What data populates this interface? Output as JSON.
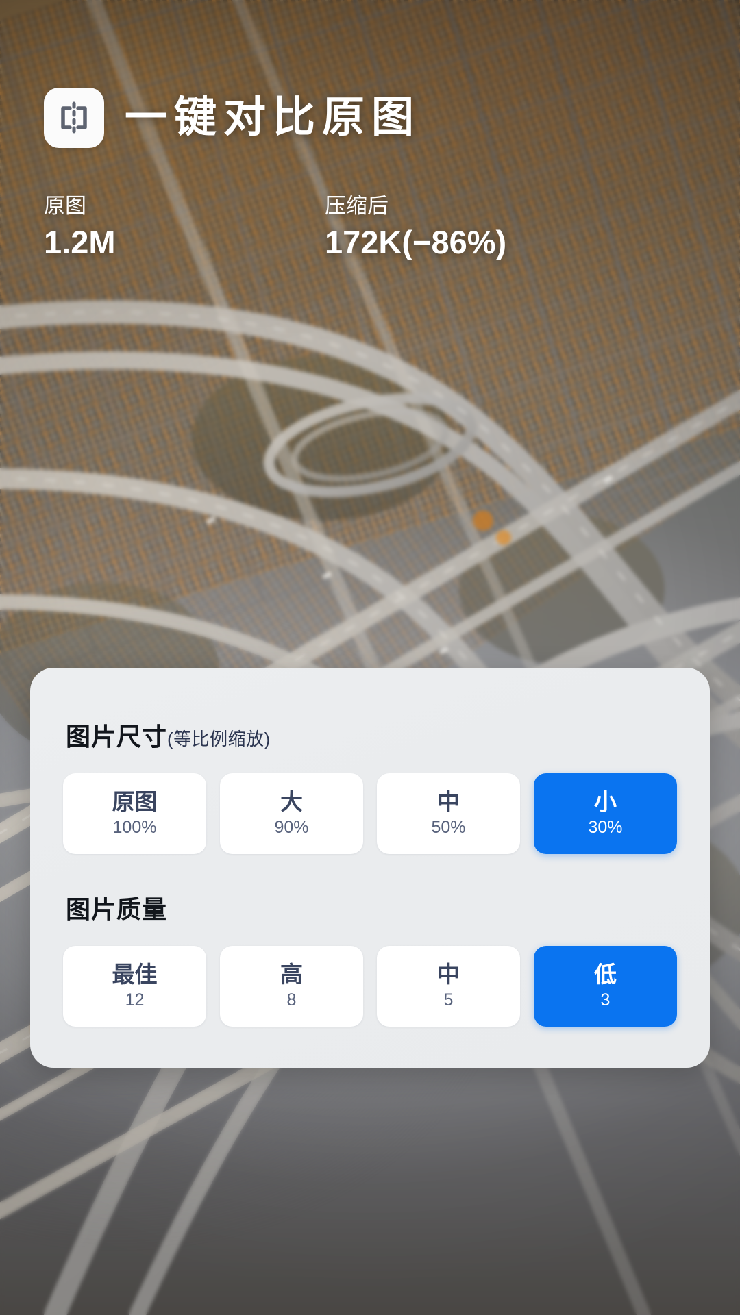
{
  "header": {
    "logo_icon": "compare-split-icon",
    "title": "一键对比原图"
  },
  "stats": {
    "original": {
      "label": "原图",
      "value": "1.2M"
    },
    "compressed": {
      "label": "压缩后",
      "value": "172K(−86%)"
    }
  },
  "settings": {
    "size_section": {
      "title": "图片尺寸",
      "note": "(等比例缩放)",
      "options": [
        {
          "label": "原图",
          "sub": "100%",
          "selected": false
        },
        {
          "label": "大",
          "sub": "90%",
          "selected": false
        },
        {
          "label": "中",
          "sub": "50%",
          "selected": false
        },
        {
          "label": "小",
          "sub": "30%",
          "selected": true
        }
      ]
    },
    "quality_section": {
      "title": "图片质量",
      "note": "",
      "options": [
        {
          "label": "最佳",
          "sub": "12",
          "selected": false
        },
        {
          "label": "高",
          "sub": "8",
          "selected": false
        },
        {
          "label": "中",
          "sub": "5",
          "selected": false
        },
        {
          "label": "低",
          "sub": "3",
          "selected": true
        }
      ]
    }
  },
  "colors": {
    "accent": "#0a74f0",
    "card_bg": "#ebedef",
    "option_bg": "#ffffff",
    "option_text": "#3a4560",
    "heading_text": "#12161c",
    "note_text": "#2b3550",
    "overlay_text": "#ffffff"
  }
}
